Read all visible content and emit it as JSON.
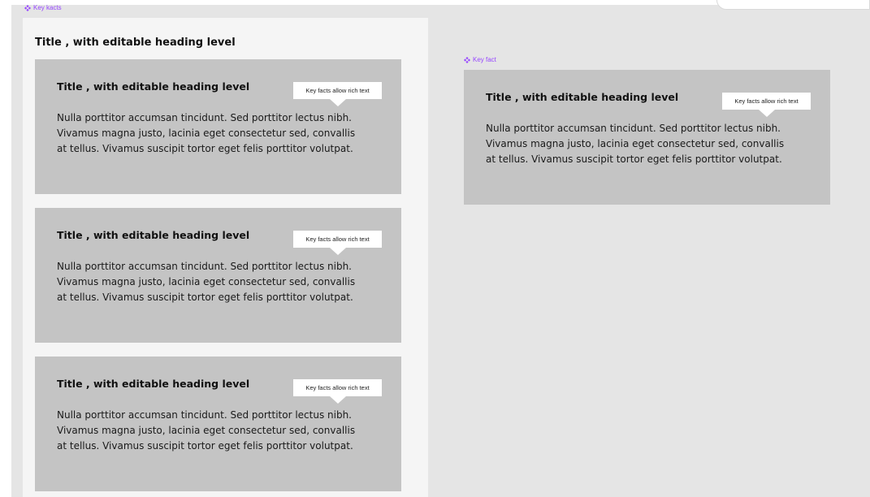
{
  "frame_tags": {
    "left": "Key kacts",
    "right": "Key fact"
  },
  "left_panel": {
    "title": "Title , with editable heading level",
    "cards": [
      {
        "title": "Title , with editable heading level",
        "tooltip": "Key facts allow rich text",
        "body": "Nulla porttitor accumsan tincidunt. Sed porttitor lectus nibh. Vivamus magna justo, lacinia eget consectetur sed, convallis at tellus. Vivamus suscipit tortor eget felis porttitor volutpat."
      },
      {
        "title": "Title , with editable heading level",
        "tooltip": "Key facts allow rich text",
        "body": "Nulla porttitor accumsan tincidunt. Sed porttitor lectus nibh. Vivamus magna justo, lacinia eget consectetur sed, convallis at tellus. Vivamus suscipit tortor eget felis porttitor volutpat."
      },
      {
        "title": "Title , with editable heading level",
        "tooltip": "Key facts allow rich text",
        "body": "Nulla porttitor accumsan tincidunt. Sed porttitor lectus nibh. Vivamus magna justo, lacinia eget consectetur sed, convallis at tellus. Vivamus suscipit tortor eget felis porttitor volutpat."
      }
    ]
  },
  "right_card": {
    "title": "Title , with editable heading level",
    "tooltip": "Key facts allow rich text",
    "body": "Nulla porttitor accumsan tincidunt. Sed porttitor lectus nibh. Vivamus magna justo, lacinia eget consectetur sed, convallis at tellus. Vivamus suscipit tortor eget felis porttitor volutpat."
  },
  "colors": {
    "component_accent": "#9747ff",
    "canvas": "#e5e5e5",
    "panel": "#f5f5f5",
    "card": "#c4c4c4",
    "tooltip": "#ffffff"
  }
}
